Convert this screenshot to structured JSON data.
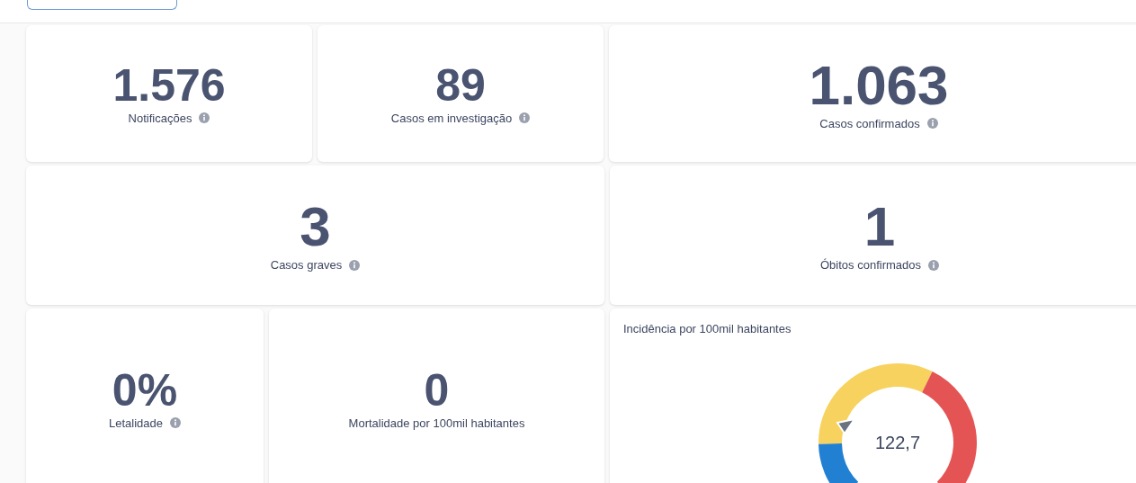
{
  "rows": [
    [
      {
        "kind": "stat",
        "value": "1.576",
        "label": "Notificações",
        "info": true
      },
      {
        "kind": "stat",
        "value": "89",
        "label": "Casos em investigação",
        "info": true
      },
      {
        "kind": "stat",
        "value": "1.063",
        "label": "Casos confirmados",
        "info": true
      }
    ],
    [
      {
        "kind": "stat",
        "value": "3",
        "label": "Casos graves",
        "info": true
      },
      {
        "kind": "stat",
        "value": "1",
        "label": "Óbitos confirmados",
        "info": true
      }
    ],
    [
      {
        "kind": "stat",
        "value": "0%",
        "label": "Letalidade",
        "info": true
      },
      {
        "kind": "stat",
        "value": "0",
        "label": "Mortalidade por 100mil habitantes",
        "info": false
      },
      {
        "kind": "gauge",
        "title": "Incidência por 100mil habitantes",
        "value": "122,7"
      }
    ]
  ]
}
